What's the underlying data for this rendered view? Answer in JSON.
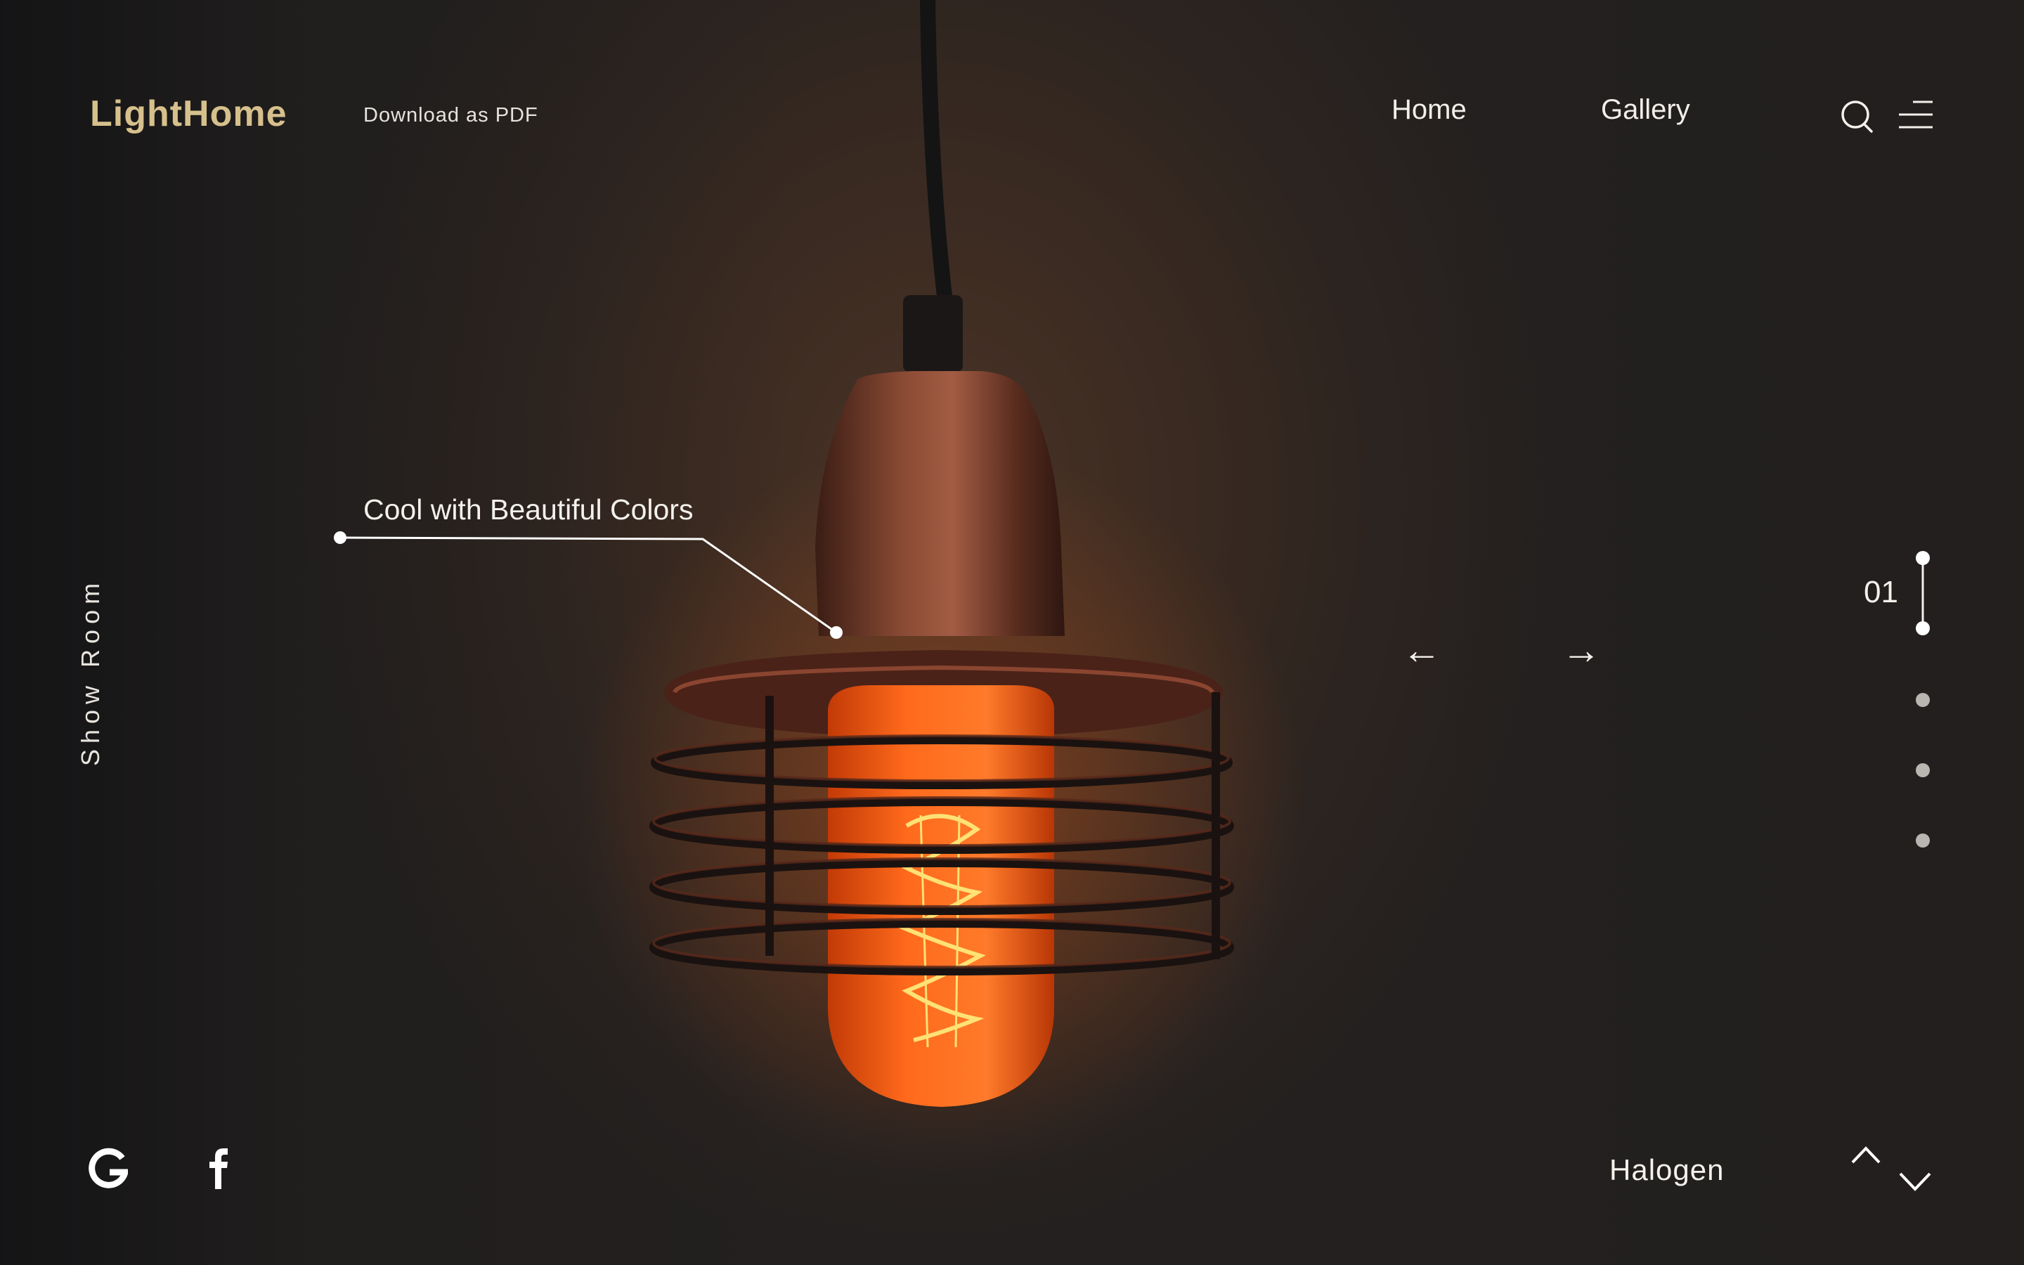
{
  "brand": {
    "logo": "LightHome",
    "accent_color": "#d6c08c"
  },
  "header": {
    "download_link": "Download as PDF",
    "nav": [
      {
        "label": "Home"
      },
      {
        "label": "Gallery"
      }
    ],
    "icons": [
      "search-icon",
      "menu-icon"
    ]
  },
  "sidebar": {
    "label": "Show Room"
  },
  "hero": {
    "callout": "Cool with Beautiful Colors",
    "prev_arrow": "←",
    "next_arrow": "→",
    "product_name": "Halogen"
  },
  "pagination": {
    "current": "01",
    "total_dots": 4,
    "active_index": 1
  },
  "social": [
    "google-icon",
    "facebook-icon"
  ],
  "scroll_controls": [
    "chevron-up-icon",
    "chevron-down-icon"
  ]
}
